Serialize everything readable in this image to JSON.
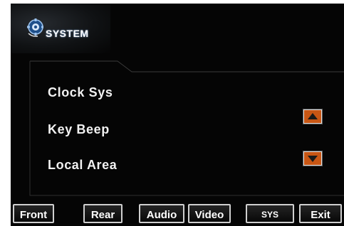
{
  "header": {
    "title": "SYSTEM",
    "logo_icon": "gear-globe-icon"
  },
  "menu": {
    "items": [
      {
        "label": "Clock Sys"
      },
      {
        "label": "Key Beep"
      },
      {
        "label": "Local Area"
      }
    ]
  },
  "scroll": {
    "up_icon": "triangle-up-icon",
    "down_icon": "triangle-down-icon"
  },
  "tabs": [
    {
      "label": "Front"
    },
    {
      "label": "Rear"
    },
    {
      "label": "Audio"
    },
    {
      "label": "Video"
    },
    {
      "label": "SYS"
    },
    {
      "label": "Exit"
    }
  ],
  "colors": {
    "background": "#050505",
    "accent": "#c85614",
    "text": "#f2f2f2",
    "outline": "#3a3a3a"
  }
}
